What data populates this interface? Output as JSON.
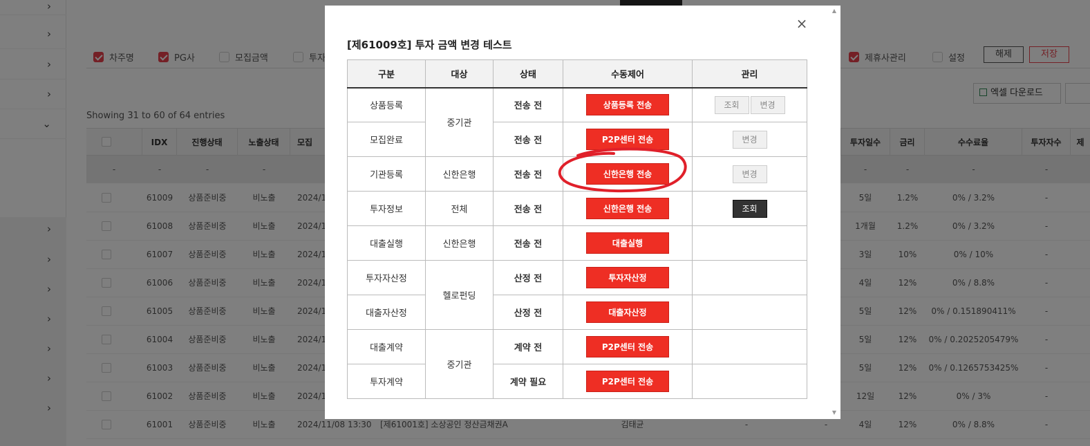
{
  "colors": {
    "accent_red": "#ee2e24",
    "status_red": "#e53223",
    "annotation": "#e0202a"
  },
  "columns_picker": [
    {
      "label": "차주명",
      "checked": true
    },
    {
      "label": "PG사",
      "checked": true
    },
    {
      "label": "모집금액",
      "checked": false
    },
    {
      "label": "투자",
      "checked": false
    },
    {
      "label": "제휴사관리",
      "checked": true
    },
    {
      "label": "설정",
      "checked": false
    }
  ],
  "toolbar": {
    "reset_label": "해제",
    "save_label": "저장",
    "excel_label": "엑셀 다운로드"
  },
  "listing": {
    "showing": "Showing 31 to 60 of 64 entries",
    "headers_left": [
      "IDX",
      "진행상태",
      "노출상태",
      "모집"
    ],
    "headers_right": [
      "투자일수",
      "금리",
      "수수료율",
      "투자자수",
      "제"
    ],
    "sub_left": [
      "-",
      "-",
      "-",
      "-"
    ],
    "sub_right": [
      "-",
      "-",
      "-",
      "-"
    ],
    "rows": [
      {
        "idx": "61009",
        "progress": "상품준비중",
        "exposure": "비노출",
        "date": "2024/1",
        "days": "5일",
        "rate": "1.2%",
        "fee": "0% / 3.2%",
        "investors": "-"
      },
      {
        "idx": "61008",
        "progress": "상품준비중",
        "exposure": "비노출",
        "date": "2024/1",
        "days": "1개월",
        "rate": "1.2%",
        "fee": "0% / 3.2%",
        "investors": "-"
      },
      {
        "idx": "61007",
        "progress": "상품준비중",
        "exposure": "비노출",
        "date": "2024/1",
        "days": "3일",
        "rate": "10%",
        "fee": "0% / 10%",
        "investors": "-"
      },
      {
        "idx": "61006",
        "progress": "상품준비중",
        "exposure": "비노출",
        "date": "2024/1",
        "days": "4일",
        "rate": "12%",
        "fee": "0% / 8.8%",
        "investors": "-"
      },
      {
        "idx": "61005",
        "progress": "상품준비중",
        "exposure": "비노출",
        "date": "2024/1",
        "days": "5일",
        "rate": "12%",
        "fee": "0% / 0.151890411%",
        "investors": "-"
      },
      {
        "idx": "61004",
        "progress": "상품준비중",
        "exposure": "비노출",
        "date": "2024/1",
        "days": "5일",
        "rate": "12%",
        "fee": "0% / 0.2025205479%",
        "investors": "-"
      },
      {
        "idx": "61003",
        "progress": "상품준비중",
        "exposure": "비노출",
        "date": "2024/1",
        "days": "5일",
        "rate": "12%",
        "fee": "0% / 0.1265753425%",
        "investors": "-"
      },
      {
        "idx": "61002",
        "progress": "상품준비중",
        "exposure": "비노출",
        "date": "2024/1",
        "days": "12일",
        "rate": "12%",
        "fee": "0% / 3%",
        "investors": "-"
      },
      {
        "idx": "61001",
        "progress": "상품준비중",
        "exposure": "비노출",
        "date": "2024/11/08 13:30",
        "title": "[제61001호] 소상공인 정산금채권A",
        "borrower": "김태균",
        "dash1": "-",
        "dash2": "-",
        "days": "4일",
        "rate": "12%",
        "fee": "0% / 8.8%",
        "investors": "-"
      }
    ]
  },
  "modal": {
    "title": "[제61009호] 투자 금액 변경 테스트",
    "close_label": "×",
    "headers": [
      "구분",
      "대상",
      "상태",
      "수동제어",
      "관리"
    ],
    "rows": [
      {
        "category": "상품등록",
        "target": "중기관",
        "status": "전송 전",
        "action": "상품등록 전송",
        "manage": [
          "조회",
          "변경"
        ]
      },
      {
        "category": "모집완료",
        "target": "",
        "status": "전송 전",
        "action": "P2P센터 전송",
        "manage": [
          "변경"
        ]
      },
      {
        "category": "기관등록",
        "target": "신한은행",
        "status": "전송 전",
        "action": "신한은행 전송",
        "manage": [
          "변경"
        ]
      },
      {
        "category": "투자정보",
        "target": "전체",
        "status": "전송 전",
        "action": "신한은행 전송",
        "manage": [
          "조회"
        ]
      },
      {
        "category": "대출실행",
        "target": "신한은행",
        "status": "전송 전",
        "action": "대출실행",
        "manage": []
      },
      {
        "category": "투자자산정",
        "target": "헬로펀딩",
        "status": "산정 전",
        "action": "투자자산정",
        "manage": []
      },
      {
        "category": "대출자산정",
        "target": "",
        "status": "산정 전",
        "action": "대출자산정",
        "manage": []
      },
      {
        "category": "대출계약",
        "target": "중기관",
        "status": "계약 전",
        "action": "P2P센터 전송",
        "manage": []
      },
      {
        "category": "투자계약",
        "target": "",
        "status": "계약 필요",
        "action": "P2P센터 전송",
        "manage": []
      }
    ]
  }
}
